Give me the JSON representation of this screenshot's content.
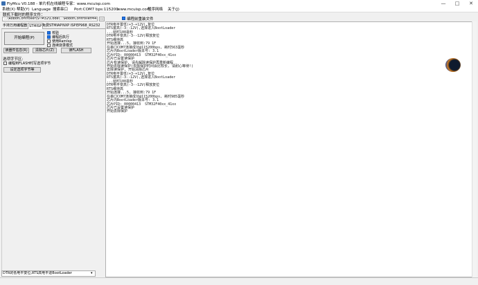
{
  "window": {
    "title": "FlyMcu V0.188 - 单片机在线编程专家：www.mcuisp.com",
    "minimize": "—",
    "maximize": "□",
    "close": "✕"
  },
  "menu": {
    "items": [
      "搜索串口",
      "Port:COM7",
      "bps:115200",
      "www.mcuisp.com",
      "程序网络",
      "关于(J)"
    ],
    "left_items": [
      "系统(X)",
      "帮助(Y)",
      "Language"
    ]
  },
  "file": {
    "label": "联机下载时的程序文件：",
    "path": "...\\RobotController\\STM32\\Code\\...\\RobotControllerM4.hex",
    "browse": "...",
    "reload_label": "编程前重装文件"
  },
  "tabs": [
    "手持万用编程器",
    "STMISP",
    "免费STMIAP",
    "NXP ISP",
    "EP968_RS232"
  ],
  "actions": {
    "start": "开始编程(P)",
    "read_info": "读器件信息(R)",
    "erase_chip": "清除芯片(Z)",
    "read_flash": "读FLASH",
    "set_option": "设定选项字节等"
  },
  "options": {
    "verify": "校验",
    "run_after": "编程后执行",
    "use_ramisp": "使用RamIsp",
    "continuous": "连续烧录模式"
  },
  "option_bytes": {
    "label": "选项字节区:",
    "write_option": "编程到FLASH时写选项字节"
  },
  "status_combo": "DTR的低电平复位,RTS高电平进BootLoader",
  "log": "DTR电平置低(+3-+12V),复位\nRTS置高(-3--12V),选择进入BootLoader\n...延时100毫秒\nDTR电平变高(-3--12V)释放复位\nRTS维持高\n开始连接...5, 接收到:79 1F\n在串口COM7连接成功@115200bps, 耗时563毫秒\n芯片内BootLoader版本号: 3.1\n芯片PID: 00000413  STM32F40xx_41xx\n芯片已设置读保护\n芯片有读保护, 请先解除读保护再重新编程\n开始去除读保护(去除保护时间会比较长, 请耐心等待!)\n去除读保护, 开始清除芯片\nDTR电平置低(+3-+12V),复位\nRTS置高(-3--12V),选择进入BootLoader\n...延时100毫秒\nDTR电平变高(-3--12V)释放复位\nRTS维持高\n开始连接...5, 接收到:79 1F\n在串口COM7连接成功@115200bps, 耗时985毫秒\n芯片内BootLoader版本号: 3.1\n芯片PID: 00000413  STM32F40xx_41xx\n芯片已设置读保护\n开始去除保护",
  "colors": {
    "accent": "#1e73e8",
    "window_bg": "#f0f0f0",
    "output_bg": "#ffffff"
  }
}
